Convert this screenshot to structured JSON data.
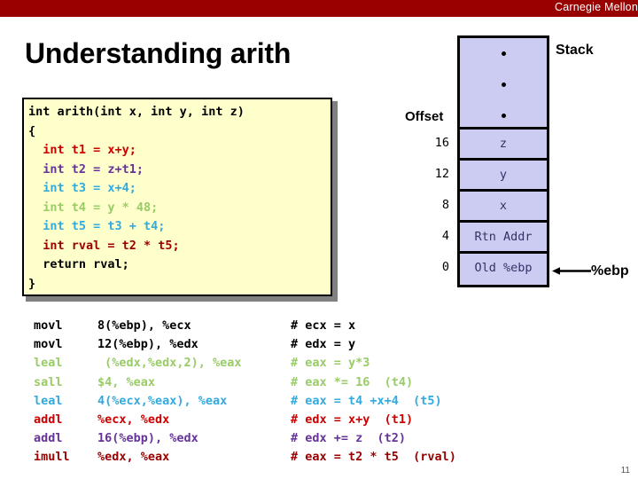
{
  "banner": {
    "institution": "Carnegie Mellon",
    "color": "#990000"
  },
  "slide": {
    "title": "Understanding arith",
    "page_number": "11"
  },
  "code_box": {
    "background": "#ffffcc",
    "lines": [
      {
        "text": "int arith(int x, int y, int z)",
        "color": "#000000"
      },
      {
        "text": "{",
        "color": "#000000"
      },
      {
        "text": "  int t1 = x+y;",
        "color": "#cc0000"
      },
      {
        "text": "  int t2 = z+t1;",
        "color": "#663399"
      },
      {
        "text": "  int t3 = x+4;",
        "color": "#33aadd"
      },
      {
        "text": "  int t4 = y * 48;",
        "color": "#99cc66"
      },
      {
        "text": "  int t5 = t3 + t4;",
        "color": "#33aadd"
      },
      {
        "text": "  int rval = t2 * t5;",
        "color": "#990000"
      },
      {
        "text": "  return rval;",
        "color": "#000000"
      },
      {
        "text": "}",
        "color": "#000000"
      }
    ]
  },
  "stack": {
    "title": "Stack",
    "offset_label": "Offset",
    "pointer_label": "%ebp",
    "cell_background": "#ccccf2",
    "dots_count": 3,
    "rows": [
      {
        "offset": "16",
        "value": "z"
      },
      {
        "offset": "12",
        "value": "y"
      },
      {
        "offset": "8",
        "value": "x"
      },
      {
        "offset": "4",
        "value": "Rtn Addr"
      },
      {
        "offset": "0",
        "value": "Old %ebp"
      }
    ]
  },
  "assembly": {
    "rows": [
      {
        "op": "movl",
        "args": "8(%ebp), %ecx",
        "comment": "# ecx = x",
        "color": "#000000"
      },
      {
        "op": "movl",
        "args": "12(%ebp), %edx",
        "comment": "# edx = y",
        "color": "#000000"
      },
      {
        "op": "leal",
        "args": " (%edx,%edx,2), %eax",
        "comment": "# eax = y*3",
        "color": "#99cc66"
      },
      {
        "op": "sall",
        "args": "$4, %eax",
        "comment": "# eax *= 16  (t4)",
        "color": "#99cc66"
      },
      {
        "op": "leal",
        "args": "4(%ecx,%eax), %eax",
        "comment": "# eax = t4 +x+4  (t5)",
        "color": "#33aadd"
      },
      {
        "op": "addl",
        "args": "%ecx, %edx",
        "comment": "# edx = x+y  (t1)",
        "color": "#cc0000"
      },
      {
        "op": "addl",
        "args": "16(%ebp), %edx",
        "comment": "# edx += z  (t2)",
        "color": "#663399"
      },
      {
        "op": "imull",
        "args": "%edx, %eax",
        "comment": "# eax = t2 * t5  (rval)",
        "color": "#990000"
      }
    ]
  }
}
